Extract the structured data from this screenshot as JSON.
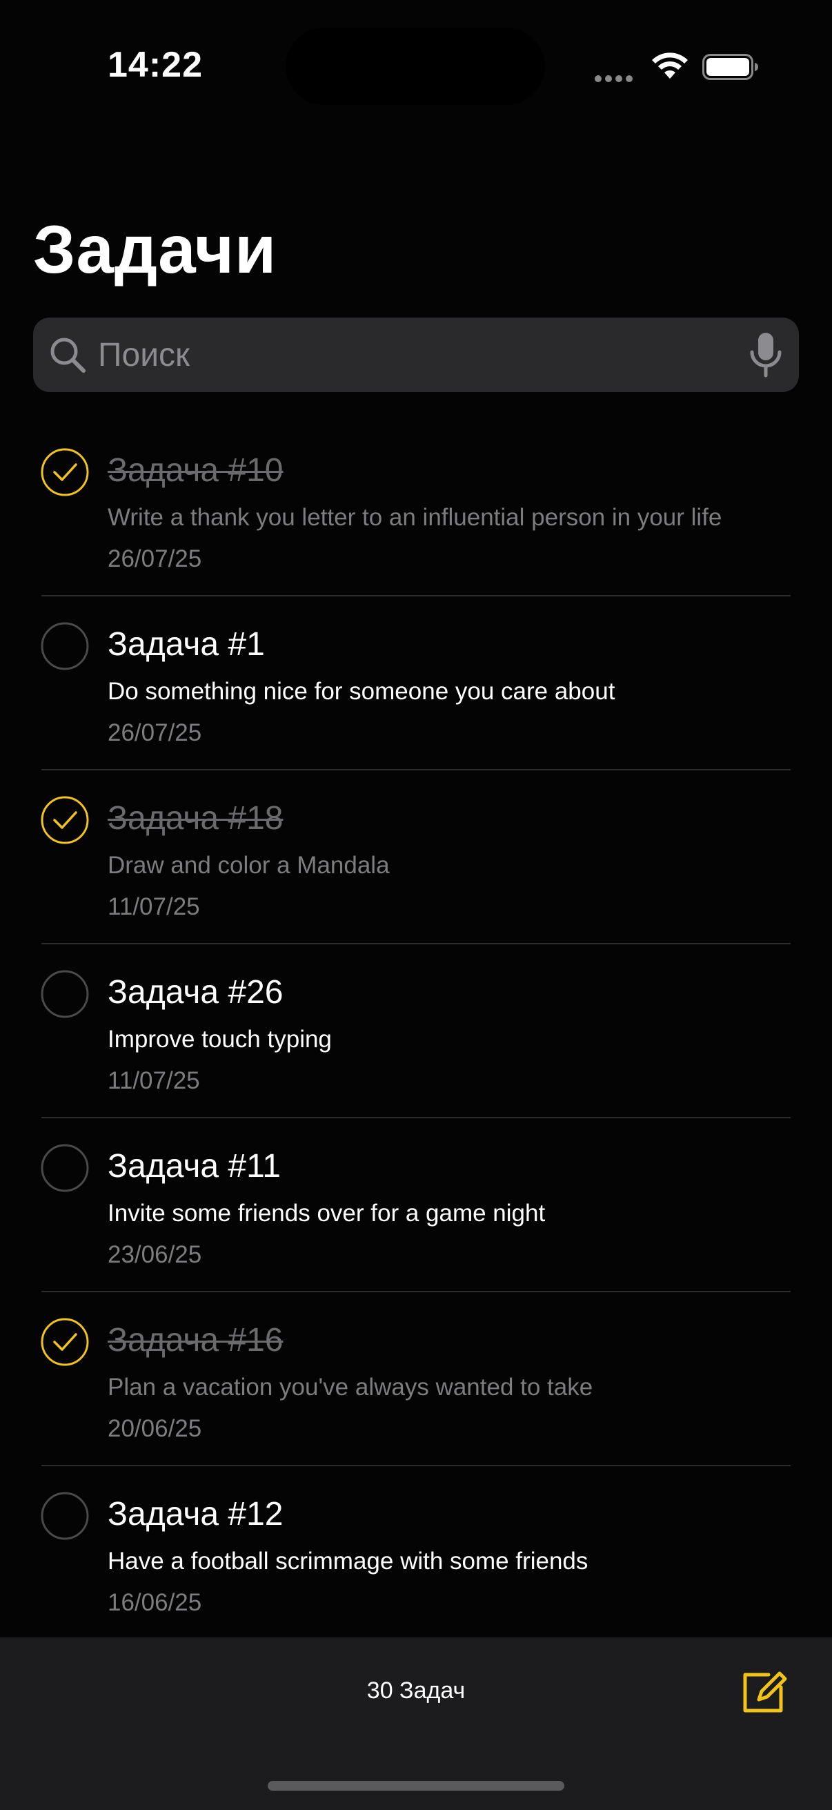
{
  "status_bar": {
    "time": "14:22"
  },
  "header": {
    "title": "Задачи"
  },
  "search": {
    "placeholder": "Поиск",
    "icon": "magnifier-icon",
    "mic_icon": "microphone-icon"
  },
  "tasks": [
    {
      "title": "Задача #10",
      "description": "Write a thank you letter to an influential person in your life",
      "date": "26/07/25",
      "completed": true
    },
    {
      "title": "Задача #1",
      "description": "Do something nice for someone you care about",
      "date": "26/07/25",
      "completed": false
    },
    {
      "title": "Задача #18",
      "description": "Draw and color a Mandala",
      "date": "11/07/25",
      "completed": true
    },
    {
      "title": "Задача #26",
      "description": "Improve touch typing",
      "date": "11/07/25",
      "completed": false
    },
    {
      "title": "Задача #11",
      "description": "Invite some friends over for a game night",
      "date": "23/06/25",
      "completed": false
    },
    {
      "title": "Задача #16",
      "description": "Plan a vacation you've always wanted to take",
      "date": "20/06/25",
      "completed": true
    },
    {
      "title": "Задача #12",
      "description": "Have a football scrimmage with some friends",
      "date": "16/06/25",
      "completed": false
    }
  ],
  "footer": {
    "count_label": "30 Задач",
    "compose_icon": "compose-icon"
  },
  "colors": {
    "accent": "#f2c318",
    "background": "#040404",
    "search_bg": "#2a2a2c",
    "toolbar_bg": "#1c1c1e",
    "muted_text": "#7d7d80"
  }
}
